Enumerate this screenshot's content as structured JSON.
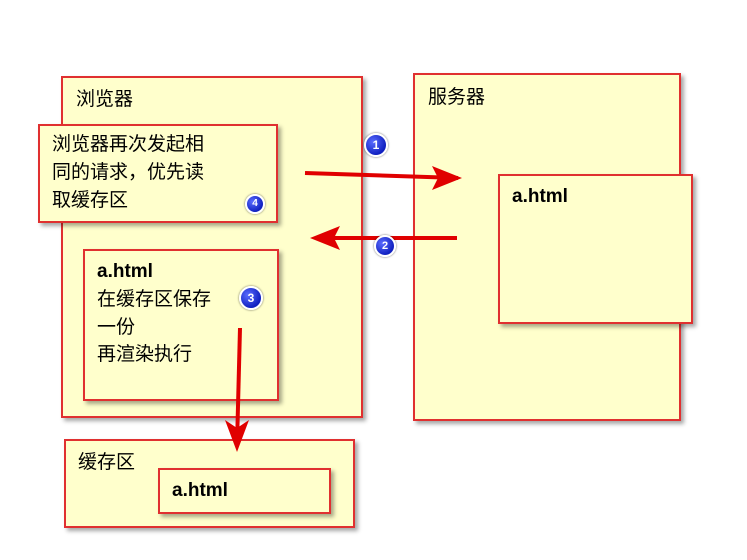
{
  "browser": {
    "title": "浏览器",
    "request_note": [
      "浏览器再次发起相",
      "同的请求，优先读",
      "取缓存区"
    ],
    "render_note": {
      "file": "a.html",
      "lines": [
        "在缓存区保存",
        "一份",
        "再渲染执行"
      ]
    }
  },
  "server": {
    "title": "服务器",
    "file": "a.html"
  },
  "cache": {
    "title": "缓存区",
    "file": "a.html"
  },
  "steps": [
    "1",
    "2",
    "3",
    "4"
  ],
  "colors": {
    "box_fill": "#ffffcc",
    "box_border": "#e03030",
    "arrow": "#e00000",
    "badge": "#1a2bd8"
  }
}
